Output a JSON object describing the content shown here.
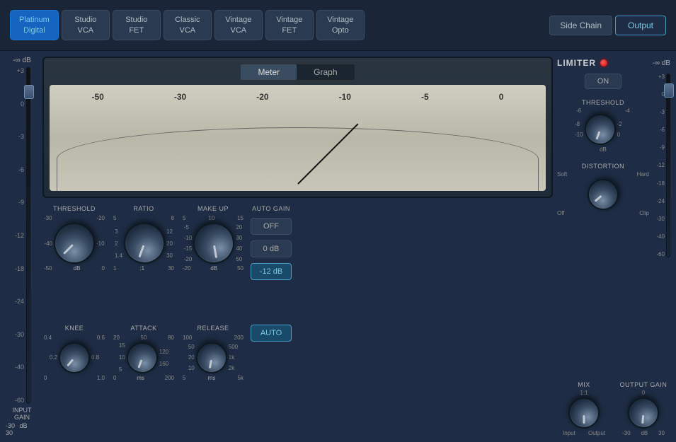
{
  "topBar": {
    "presets": [
      {
        "id": "platinum-digital",
        "label": "Platinum\nDigital",
        "active": true
      },
      {
        "id": "studio-vca",
        "label": "Studio\nVCA",
        "active": false
      },
      {
        "id": "studio-fet",
        "label": "Studio\nFET",
        "active": false
      },
      {
        "id": "classic-vca",
        "label": "Classic\nVCA",
        "active": false
      },
      {
        "id": "vintage-vca",
        "label": "Vintage\nVCA",
        "active": false
      },
      {
        "id": "vintage-fet",
        "label": "Vintage\nFET",
        "active": false
      },
      {
        "id": "vintage-opto",
        "label": "Vintage\nOpto",
        "active": false
      }
    ],
    "chainButtons": [
      {
        "id": "side-chain",
        "label": "Side Chain",
        "active": false
      },
      {
        "id": "output",
        "label": "Output",
        "active": true
      }
    ]
  },
  "inputGain": {
    "label": "INPUT GAIN",
    "topValue": "-∞ dB",
    "unit": "dB",
    "minLabel": "-30",
    "maxLabel": "30",
    "scaleMarks": [
      "+3",
      "0",
      "-3",
      "-6",
      "-9",
      "-12",
      "-18",
      "-24",
      "-30",
      "-40",
      "-60"
    ]
  },
  "meter": {
    "tabs": [
      {
        "label": "Meter",
        "active": true
      },
      {
        "label": "Graph",
        "active": false
      }
    ],
    "scaleValues": [
      "-50",
      "-30",
      "-20",
      "-10",
      "-5",
      "0"
    ]
  },
  "threshold": {
    "label": "THRESHOLD",
    "scaleTop": [
      "-30",
      "-20"
    ],
    "scaleBottom": [
      "-50",
      "-40",
      "-10",
      "0"
    ],
    "unit": "dB"
  },
  "ratio": {
    "label": "RATIO",
    "scaleTop": [
      "5",
      "8"
    ],
    "scaleLeft": [
      "3",
      "2",
      "1.4",
      "1"
    ],
    "scaleRight": [
      "12",
      "20",
      "30"
    ],
    "unit": ":1"
  },
  "makeup": {
    "label": "MAKE UP",
    "scaleTop": [
      "5",
      "10",
      "15"
    ],
    "scaleLeft": [
      "-5",
      "-10",
      "-15",
      "-20"
    ],
    "scaleRight": [
      "20",
      "30",
      "40",
      "50"
    ],
    "unit": "dB"
  },
  "autoGain": {
    "label": "AUTO GAIN",
    "buttons": [
      {
        "label": "OFF",
        "active": false
      },
      {
        "label": "0 dB",
        "active": false
      },
      {
        "label": "-12 dB",
        "active": true
      }
    ]
  },
  "knee": {
    "label": "KNEE",
    "scaleTop": [
      "0.4",
      "0.6"
    ],
    "scaleLeft": [
      "0.2"
    ],
    "scaleRight": [
      "0.8"
    ],
    "scaleBottom": [
      "0",
      "1.0"
    ]
  },
  "attack": {
    "label": "ATTACK",
    "scaleTop": [
      "20",
      "50",
      "80"
    ],
    "scaleLeft": [
      "15",
      "10",
      "5"
    ],
    "scaleRight": [
      "120",
      "160"
    ],
    "scaleBottom": [
      "0",
      "200"
    ],
    "unit": "ms"
  },
  "release": {
    "label": "RELEASE",
    "scaleTop": [
      "100",
      "200"
    ],
    "scaleLeft": [
      "50",
      "20",
      "10"
    ],
    "scaleRight": [
      "500",
      "1k",
      "2k"
    ],
    "scaleBottom": [
      "5",
      "5k"
    ],
    "unit": "ms"
  },
  "autoBtn": {
    "label": "AUTO",
    "active": true
  },
  "limiter": {
    "label": "LIMITER",
    "topValue": "-∞ dB",
    "onLabel": "ON",
    "scaleMarks": [
      "+3",
      "0",
      "-3",
      "-6",
      "-9",
      "-12",
      "-18",
      "-24",
      "-30",
      "-40",
      "-60"
    ]
  },
  "limiterThreshold": {
    "label": "THRESHOLD",
    "scaleLeft": [
      "-8",
      "-10"
    ],
    "scaleRight": [
      "-2",
      "0"
    ],
    "scaleTopLeft": "-6",
    "scaleTopRight": "-4",
    "unit": "dB"
  },
  "distortion": {
    "label": "DISTORTION",
    "scaleTop": [
      "Soft",
      "Hard"
    ],
    "scaleBottom": [
      "Off",
      "Clip"
    ]
  },
  "mix": {
    "label": "MIX",
    "scaleLeft": "Input",
    "scaleRight": "Output",
    "scaleTop": "1:1"
  },
  "outputGain": {
    "label": "OUTPUT GAIN",
    "scaleTop": "0",
    "scaleBottom": [
      "-30",
      "30"
    ],
    "unit": "dB"
  }
}
